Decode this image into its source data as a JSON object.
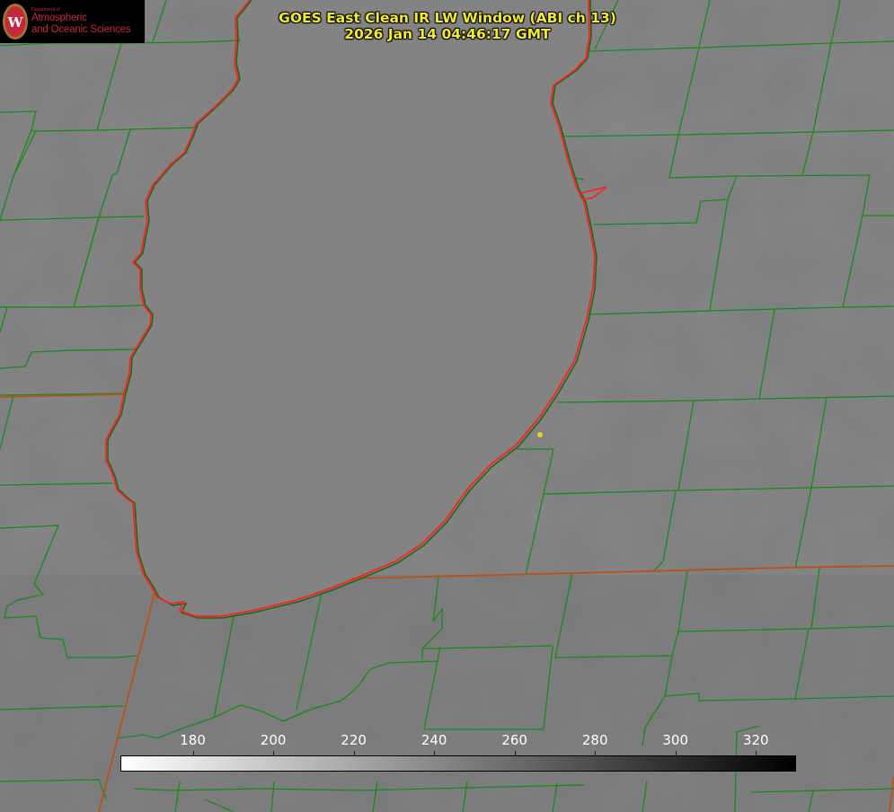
{
  "title": {
    "line1": "GOES East Clean IR LW Window (ABI ch 13)",
    "line2": "2026 Jan 14 04:46:17 GMT"
  },
  "logo": {
    "department": "Department of",
    "line1": "Atmospheric",
    "line2": "and Oceanic Sciences",
    "shield_letter": "W"
  },
  "colorbar": {
    "min": 162,
    "max": 330,
    "ticks": [
      "180",
      "200",
      "220",
      "240",
      "260",
      "280",
      "300",
      "320"
    ],
    "colors": {
      "low": "#ffffff",
      "high": "#000000"
    }
  },
  "colors": {
    "background": "#7e7e7e",
    "lake": "#858585",
    "county_lines": "#1a8a1a",
    "coastline": "#ff2020",
    "state_lines": "#b8521a",
    "title": "#f2ea2a",
    "marker": "#e8d020"
  },
  "icons": {
    "logo": "uw-crest-icon",
    "marker": "station-dot-icon"
  }
}
